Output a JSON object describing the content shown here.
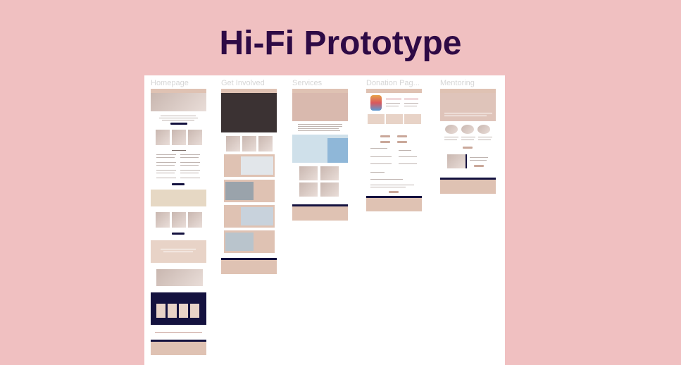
{
  "title": "Hi-Fi Prototype",
  "frames": [
    {
      "label": "Homepage"
    },
    {
      "label": "Get Involved"
    },
    {
      "label": "Services"
    },
    {
      "label": "Donation Pag..."
    },
    {
      "label": "Mentoring"
    }
  ],
  "colors": {
    "background": "#f0c0c1",
    "title": "#2e0a45",
    "accent_tan": "#dfc2b3",
    "accent_navy": "#14123f"
  }
}
